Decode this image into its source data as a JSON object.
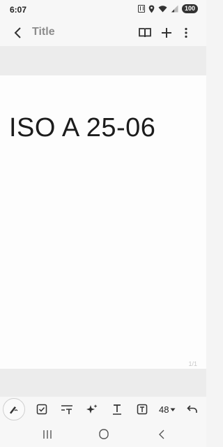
{
  "status": {
    "time": "6:07",
    "battery": "100"
  },
  "appbar": {
    "title": "Title"
  },
  "document": {
    "text": "ISO A 25-06",
    "page_counter": "1/1"
  },
  "pen_toolbar": {
    "size": "48"
  },
  "colors": {
    "accent": "#1d1d1d",
    "title_gray": "#8c8c8c",
    "background": "#f4f4f4"
  },
  "icons": [
    "back-arrow-icon",
    "book-icon",
    "plus-icon",
    "more-vert-icon",
    "pen-icon",
    "checkbox-icon",
    "text-format-icon",
    "sparkle-icon",
    "text-underline-icon",
    "text-box-icon",
    "undo-icon",
    "recents-icon",
    "home-icon",
    "back-icon"
  ]
}
